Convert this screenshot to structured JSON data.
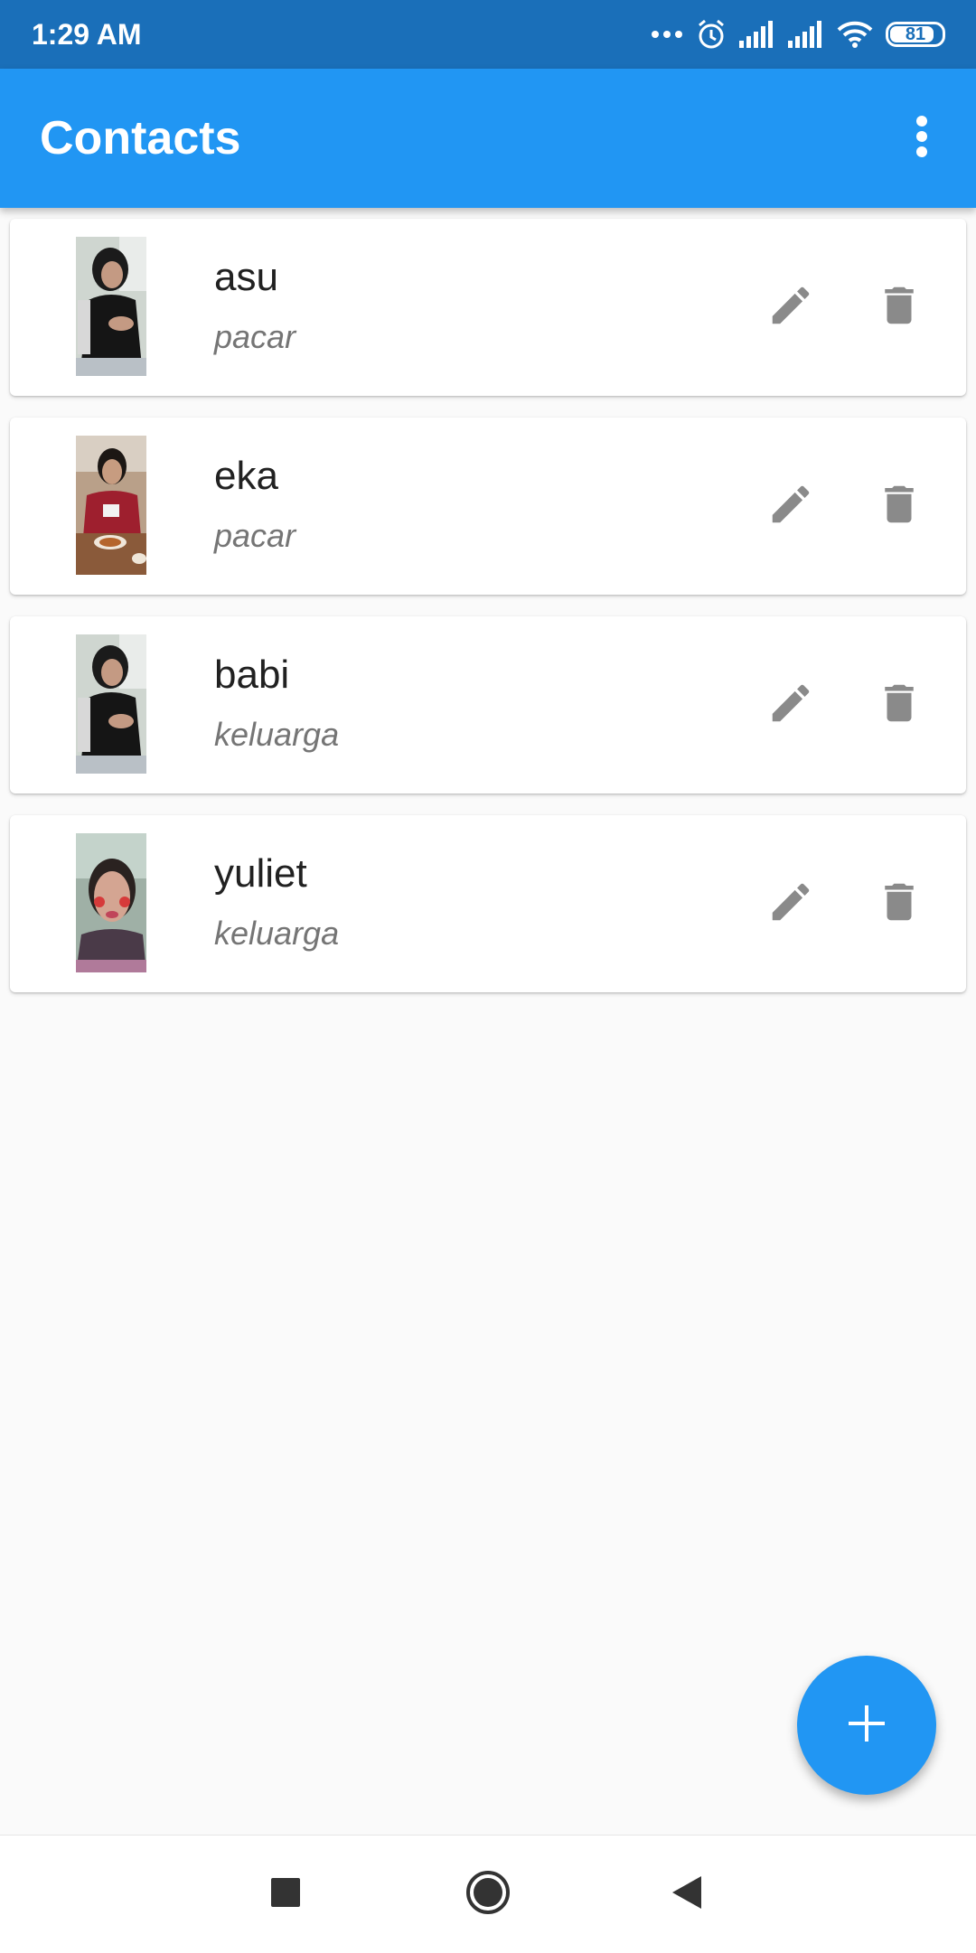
{
  "status_bar": {
    "time": "1:29 AM",
    "battery": "81",
    "icons": [
      "more-dots-icon",
      "alarm-icon",
      "signal-icon",
      "signal-icon",
      "wifi-icon",
      "battery-icon"
    ]
  },
  "app_bar": {
    "title": "Contacts",
    "menu_icon": "more-vert-icon"
  },
  "contacts": [
    {
      "name": "asu",
      "group": "pacar"
    },
    {
      "name": "eka",
      "group": "pacar"
    },
    {
      "name": "babi",
      "group": "keluarga"
    },
    {
      "name": "yuliet",
      "group": "keluarga"
    }
  ],
  "row_actions": {
    "edit_icon": "pencil-icon",
    "delete_icon": "trash-icon"
  },
  "fab": {
    "icon": "plus-icon"
  },
  "nav_bar": {
    "buttons": [
      "recents-icon",
      "home-icon",
      "back-icon"
    ]
  },
  "colors": {
    "status_bar": "#1a6fb9",
    "app_bar": "#2196f3",
    "background": "#fafafa",
    "icon_grey": "#8a8a8a"
  }
}
